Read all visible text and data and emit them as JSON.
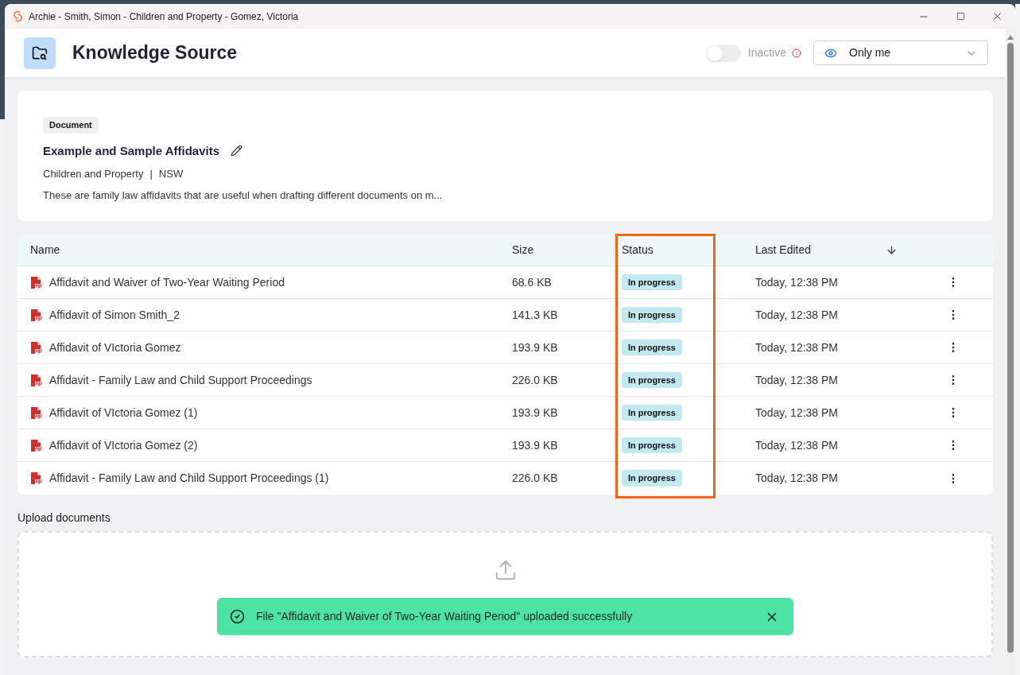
{
  "window": {
    "title": "Archie - Smith, Simon - Children and Property - Gomez, Victoria"
  },
  "header": {
    "title": "Knowledge Source",
    "toggle": {
      "label": "Inactive",
      "on": false
    },
    "visibility": {
      "value": "Only me"
    }
  },
  "document": {
    "tag": "Document",
    "title": "Example and Sample Affidavits",
    "category": "Children and Property",
    "separator": "|",
    "region": "NSW",
    "description": "These are family law affidavits that are useful when drafting different documents on m..."
  },
  "table": {
    "columns": [
      "Name",
      "Size",
      "Status",
      "Last Edited"
    ],
    "rows": [
      {
        "name": "Affidavit and Waiver of Two-Year Waiting Period",
        "size": "68.6 KB",
        "status": "In progress",
        "edited": "Today, 12:38 PM"
      },
      {
        "name": "Affidavit of Simon Smith_2",
        "size": "141.3 KB",
        "status": "In progress",
        "edited": "Today, 12:38 PM"
      },
      {
        "name": "Affidavit of VIctoria Gomez",
        "size": "193.9 KB",
        "status": "In progress",
        "edited": "Today, 12:38 PM"
      },
      {
        "name": "Affidavit - Family Law and Child Support Proceedings",
        "size": "226.0 KB",
        "status": "In progress",
        "edited": "Today, 12:38 PM"
      },
      {
        "name": "Affidavit of VIctoria Gomez (1)",
        "size": "193.9 KB",
        "status": "In progress",
        "edited": "Today, 12:38 PM"
      },
      {
        "name": "Affidavit of VIctoria Gomez (2)",
        "size": "193.9 KB",
        "status": "In progress",
        "edited": "Today, 12:38 PM"
      },
      {
        "name": "Affidavit - Family Law and Child Support Proceedings (1)",
        "size": "226.0 KB",
        "status": "In progress",
        "edited": "Today, 12:38 PM"
      }
    ]
  },
  "upload": {
    "label": "Upload documents"
  },
  "toast": {
    "message": "File \"Affidavit and Waiver of Two-Year Waiting Period\" uploaded successfully"
  }
}
